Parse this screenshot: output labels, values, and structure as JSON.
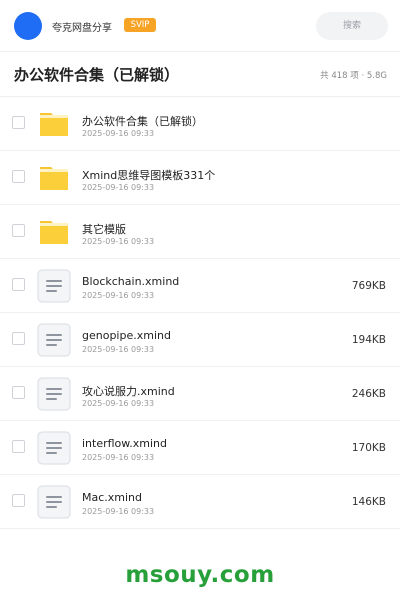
{
  "header": {
    "app_name": "夸克网盘分享",
    "badge": "SVIP",
    "search_label": "搜索",
    "avatar_color": "#1f6cf5",
    "badge_color": "#f7a326"
  },
  "folder": {
    "title": "办公软件合集（已解锁）",
    "meta": "共 418 项 · 5.8G"
  },
  "files": [
    {
      "icon": "folder-icon",
      "name": "办公软件合集（已解锁）",
      "date": "2025-09-16 09:33",
      "size": ""
    },
    {
      "icon": "folder-icon",
      "name": "Xmind思维导图模板331个",
      "date": "2025-09-16 09:33",
      "size": ""
    },
    {
      "icon": "folder-icon",
      "name": "其它模版",
      "date": "2025-09-16 09:33",
      "size": ""
    },
    {
      "icon": "document-icon",
      "name": "Blockchain.xmind",
      "date": "2025-09-16 09:33",
      "size": "769KB"
    },
    {
      "icon": "document-icon",
      "name": "genopipe.xmind",
      "date": "2025-09-16 09:33",
      "size": "194KB"
    },
    {
      "icon": "document-icon",
      "name": "攻心说服力.xmind",
      "date": "2025-09-16 09:33",
      "size": "246KB"
    },
    {
      "icon": "document-icon",
      "name": "interflow.xmind",
      "date": "2025-09-16 09:33",
      "size": "170KB"
    },
    {
      "icon": "document-icon",
      "name": "Mac.xmind",
      "date": "2025-09-16 09:33",
      "size": "146KB"
    }
  ],
  "footer": {
    "watermark": "msouy.com",
    "watermark_color": "#27a03a"
  }
}
